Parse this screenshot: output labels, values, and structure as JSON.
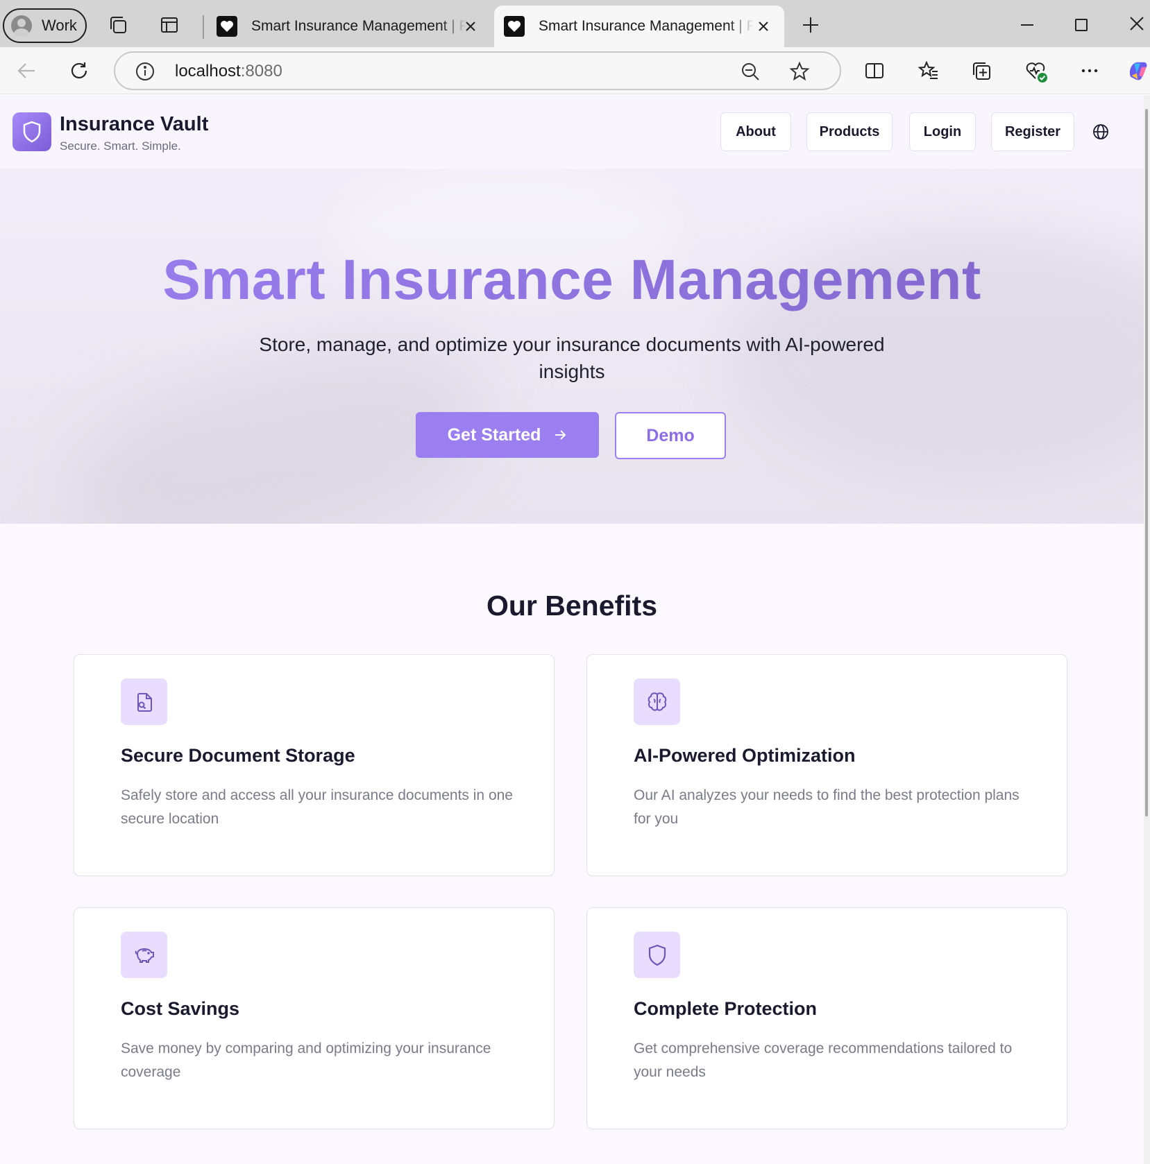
{
  "browser": {
    "profile_label": "Work",
    "tabs": [
      {
        "title": "Smart Insurance Management | Pr",
        "active": false
      },
      {
        "title": "Smart Insurance Management | Pr",
        "active": true
      }
    ],
    "url_host": "localhost",
    "url_port": ":8080"
  },
  "nav": {
    "brand_name": "Insurance Vault",
    "brand_tagline": "Secure. Smart. Simple.",
    "links": [
      "About",
      "Products",
      "Login",
      "Register"
    ]
  },
  "hero": {
    "title": "Smart Insurance Management",
    "subtitle": "Store, manage, and optimize your insurance documents with AI-powered insights",
    "primary_cta": "Get Started",
    "secondary_cta": "Demo"
  },
  "benefits": {
    "title": "Our Benefits",
    "cards": [
      {
        "icon": "file-search-icon",
        "title": "Secure Document Storage",
        "description": "Safely store and access all your insurance documents in one secure location"
      },
      {
        "icon": "brain-icon",
        "title": "AI-Powered Optimization",
        "description": "Our AI analyzes your needs to find the best protection plans for you"
      },
      {
        "icon": "piggy-bank-icon",
        "title": "Cost Savings",
        "description": "Save money by comparing and optimizing your insurance coverage"
      },
      {
        "icon": "shield-icon",
        "title": "Complete Protection",
        "description": "Get comprehensive coverage recommendations tailored to your needs"
      }
    ]
  },
  "colors": {
    "accent": "#9b7ef0",
    "accent_light": "#e8ddff",
    "text_dark": "#1a1a2e",
    "text_muted": "#7b7b88"
  }
}
